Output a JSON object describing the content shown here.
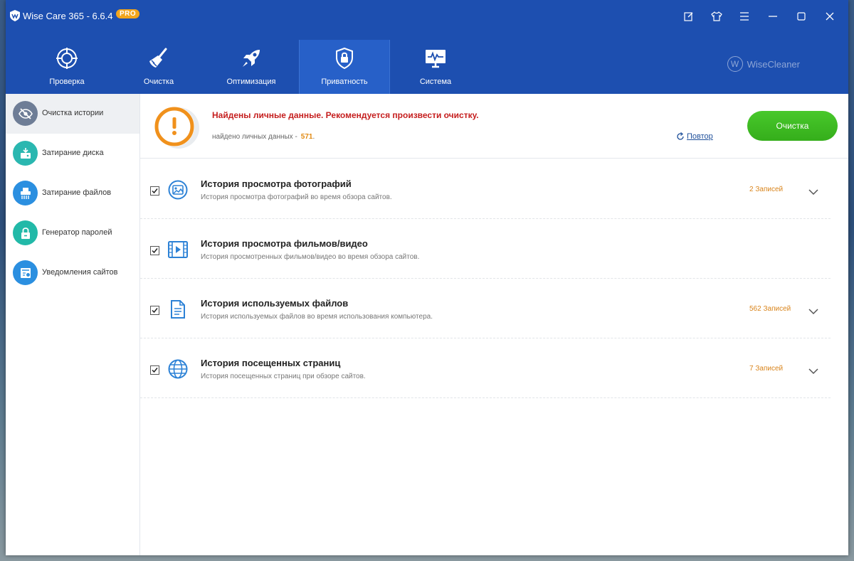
{
  "window": {
    "title": "Wise Care 365 - 6.6.4",
    "badge": "PRO",
    "brand": "WiseCleaner"
  },
  "titlebar_buttons": [
    {
      "name": "feedback-icon"
    },
    {
      "name": "skin-icon"
    },
    {
      "name": "menu-icon"
    },
    {
      "name": "minimize-icon"
    },
    {
      "name": "maximize-icon"
    },
    {
      "name": "close-icon"
    }
  ],
  "tabs": [
    {
      "label": "Проверка",
      "icon": "target-icon"
    },
    {
      "label": "Очистка",
      "icon": "broom-icon"
    },
    {
      "label": "Оптимизация",
      "icon": "rocket-icon"
    },
    {
      "label": "Приватность",
      "icon": "shield-lock-icon",
      "active": true
    },
    {
      "label": "Система",
      "icon": "monitor-icon"
    }
  ],
  "sidebar": {
    "items": [
      {
        "label": "Очистка истории",
        "icon": "eye-off-icon",
        "color": "#6e7d96",
        "active": true
      },
      {
        "label": "Затирание диска",
        "icon": "disk-eraser-icon",
        "color": "#2ab7b0"
      },
      {
        "label": "Затирание файлов",
        "icon": "shredder-icon",
        "color": "#2b8fe0"
      },
      {
        "label": "Генератор паролей",
        "icon": "password-lock-icon",
        "color": "#22b9a8"
      },
      {
        "label": "Уведомления сайтов",
        "icon": "notification-icon",
        "color": "#2b8fe0"
      }
    ]
  },
  "alert": {
    "title": "Найдены личные данные. Рекомендуется произвести очистку.",
    "found_label": "найдено личных данных -",
    "found_count": "571",
    "found_suffix": ".",
    "retry_label": "Повтор",
    "clean_button": "Очистка"
  },
  "items": [
    {
      "title": "История просмотра фотографий",
      "desc": "История просмотра фотографий во время обзора сайтов.",
      "count": "2 Записей",
      "icon": "photo-icon",
      "checked": true
    },
    {
      "title": "История просмотра фильмов/видео",
      "desc": "История просмотренных фильмов/видео во время обзора сайтов.",
      "count": "",
      "icon": "video-icon",
      "checked": true
    },
    {
      "title": "История используемых файлов",
      "desc": "История используемых файлов во время использования компьютера.",
      "count": "562 Записей",
      "icon": "document-icon",
      "checked": true
    },
    {
      "title": "История посещенных страниц",
      "desc": "История посещенных страниц при обзоре сайтов.",
      "count": "7 Записей",
      "icon": "globe-icon",
      "checked": true
    }
  ],
  "colors": {
    "header": "#1d4fb0",
    "accent_green": "#3dba22",
    "warning_red": "#c51e1e",
    "count_orange": "#d9841b"
  }
}
